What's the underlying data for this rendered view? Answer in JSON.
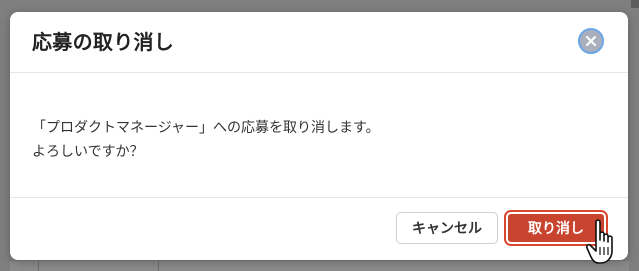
{
  "dialog": {
    "title": "応募の取り消し",
    "close_icon": "close-circle-icon",
    "message_line1": "「プロダクトマネージャー」への応募を取り消します。",
    "message_line2": "よろしいですか？",
    "cancel_label": "キャンセル",
    "confirm_label": "取り消し"
  },
  "cursor": {
    "icon": "hand-pointer-icon"
  },
  "colors": {
    "confirm_button": "#c8442e",
    "close_button_ring": "#6aa6e8",
    "close_button_fill": "#a9b0bb",
    "backdrop": "#7f7f7f"
  }
}
